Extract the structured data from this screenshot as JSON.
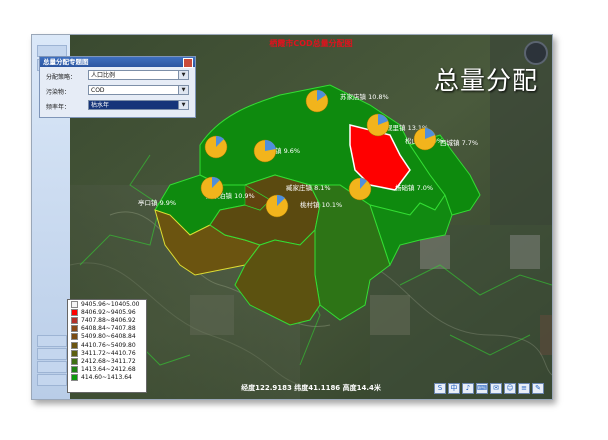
{
  "map": {
    "title": "栖霞市COD总量分配图",
    "big_label": "总量分配",
    "status_bar": "经度122.9183 纬度41.1186 高度14.4米"
  },
  "panel": {
    "title": "总量分配专题图",
    "rows": [
      {
        "label": "分配策略：",
        "value": "人口比例"
      },
      {
        "label": "污染物：",
        "value": "COD"
      },
      {
        "label": "频率年：",
        "value": "枯水年"
      }
    ]
  },
  "regions": [
    {
      "name": "苏家店镇",
      "pct": "10.8%",
      "level": 2
    },
    {
      "name": "观里镇",
      "pct": "13.1%",
      "level": 1
    },
    {
      "name": "庙后镇",
      "pct": "9.6%",
      "level": 8
    },
    {
      "name": "臧家庄镇",
      "pct": "8.1%",
      "level": 4
    },
    {
      "name": "唐家泊镇",
      "pct": "10.9%",
      "level": 6
    },
    {
      "name": "亭口镇",
      "pct": "9.9%",
      "level": 7
    },
    {
      "name": "桃村镇",
      "pct": "10.1%",
      "level": 5
    },
    {
      "name": "杨础镇",
      "pct": "7.0%",
      "level": 0
    },
    {
      "name": "松山镇",
      "pct": "5.9%",
      "level": 3
    },
    {
      "name": "西城镇",
      "pct": "7.7%",
      "level": 6
    }
  ],
  "legend": [
    {
      "label": "9405.96~10405.00",
      "color": "#f5f5f5"
    },
    {
      "label": "8406.92~9405.96",
      "color": "#ff0000"
    },
    {
      "label": "7407.88~8406.92",
      "color": "#b4302a"
    },
    {
      "label": "6408.84~7407.88",
      "color": "#8a4a18"
    },
    {
      "label": "5409.80~6408.84",
      "color": "#7a4c12"
    },
    {
      "label": "4410.76~5409.80",
      "color": "#6b5410"
    },
    {
      "label": "3411.72~4410.76",
      "color": "#5b5e10"
    },
    {
      "label": "2412.68~3411.72",
      "color": "#3f7014"
    },
    {
      "label": "1413.64~2412.68",
      "color": "#1f8414"
    },
    {
      "label": "414.60~1413.64",
      "color": "#0d9a0d"
    }
  ],
  "tray_icons": [
    "S",
    "中",
    "♪",
    "⌨",
    "✉",
    "☺",
    "≡",
    "✎"
  ],
  "colors": {
    "boundary": "#33dd33",
    "selected_outline": "#ffffff",
    "pie_main": "#f2b41c",
    "pie_slice": "#4f8fdc"
  }
}
